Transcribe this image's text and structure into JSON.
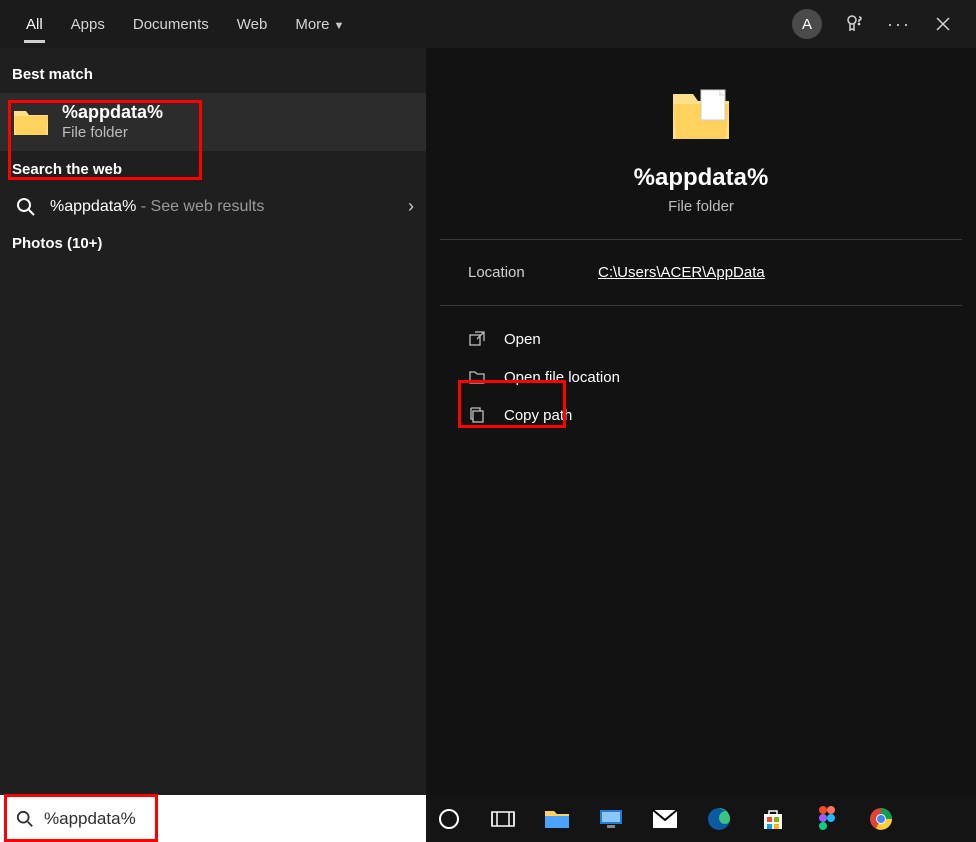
{
  "tabs": {
    "all": "All",
    "apps": "Apps",
    "documents": "Documents",
    "web": "Web",
    "more": "More"
  },
  "avatar_letter": "A",
  "sections": {
    "best_match": "Best match",
    "search_web": "Search the web",
    "photos": "Photos (10+)"
  },
  "best_match_item": {
    "title": "%appdata%",
    "subtitle": "File folder"
  },
  "web_item": {
    "term": "%appdata%",
    "suffix": " - See web results"
  },
  "preview": {
    "title": "%appdata%",
    "subtitle": "File folder",
    "location_label": "Location",
    "location_value": "C:\\Users\\ACER\\AppData"
  },
  "actions": {
    "open": "Open",
    "open_location": "Open file location",
    "copy_path": "Copy path"
  },
  "search_value": "%appdata%",
  "taskbar_icons": [
    "cortana",
    "task-view",
    "explorer",
    "screen",
    "mail",
    "edge",
    "store",
    "figma",
    "chrome"
  ]
}
